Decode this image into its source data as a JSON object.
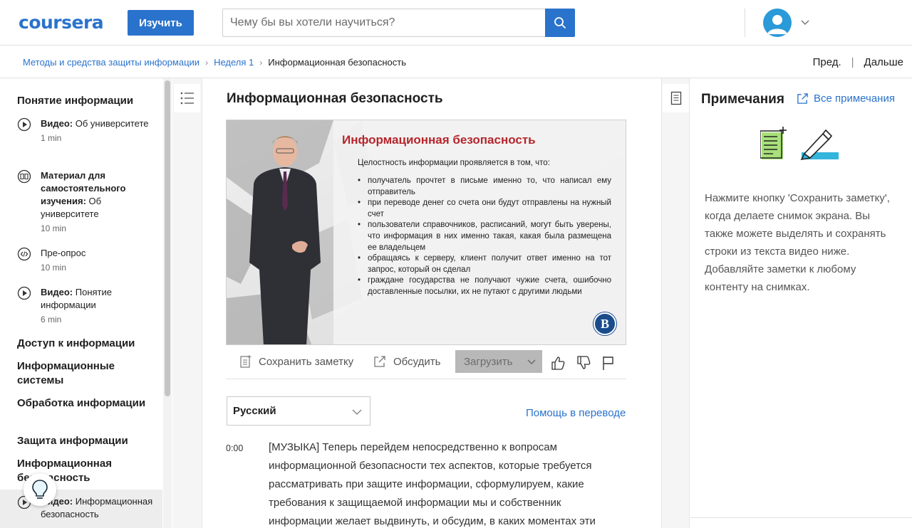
{
  "header": {
    "logo": "coursera",
    "learn_button": "Изучить",
    "search_placeholder": "Чему бы вы хотели научиться?",
    "icons": {
      "search": "search-icon",
      "avatar": "user-avatar-icon",
      "menu": "chevron-down-icon"
    }
  },
  "breadcrumb": {
    "items": [
      "Методы и средства защиты информации",
      "Неделя 1"
    ],
    "current": "Информационная безопасность",
    "prev": "Пред.",
    "separator": "|",
    "next": "Дальше"
  },
  "sidebar": {
    "sections": [
      {
        "title": "Понятие информации"
      },
      {
        "title": "Доступ к информации"
      },
      {
        "title": "Информационные системы"
      },
      {
        "title": "Обработка информации"
      },
      {
        "title": "Защита информации"
      },
      {
        "title": "Информационная безопасность"
      }
    ],
    "items": [
      {
        "type": "Видео:",
        "label": "Об университете",
        "duration": "1 min",
        "icon": "play-icon"
      },
      {
        "type": "Материал для самостоятельного изучения:",
        "label": "Об университете",
        "duration": "10 min",
        "icon": "book-icon"
      },
      {
        "type": "",
        "label": "Пре-опрос",
        "duration": "10 min",
        "icon": "code-icon"
      },
      {
        "type": "Видео:",
        "label": "Понятие информации",
        "duration": "6 min",
        "icon": "play-icon"
      },
      {
        "type": "Видео:",
        "label": "Информационная безопасность",
        "duration": "",
        "icon": "play-icon"
      }
    ]
  },
  "lesson": {
    "title": "Информационная безопасность",
    "slide": {
      "title": "Информационная безопасность",
      "intro": "Целостность информации проявляется в том, что:",
      "bullets": [
        "получатель прочтет в письме именно то, что написал ему отправитель",
        "при переводе денег со счета они будут отправлены на нужный счет",
        "пользователи справочников, расписаний, могут быть уверены, что информация в них именно такая, какая была размещена ее владельцем",
        "обращаясь к серверу, клиент получит ответ именно на тот запрос, который он сделал",
        "граждане государства не получают чужие счета, ошибочно доставленные посылки, их не путают с другими людьми"
      ],
      "logo_text": "В"
    },
    "actions": {
      "save_note": "Сохранить заметку",
      "discuss": "Обсудить",
      "download": "Загрузить"
    },
    "language": "Русский",
    "help_translate": "Помощь в переводе",
    "transcript": {
      "timestamp": "0:00",
      "text": "[МУЗЫКА] Теперь перейдем непосредственно к вопросам информационной безопасности тех аспектов, которые требуется рассматривать при защите информации, сформулируем, какие требования к защищаемой информации мы и собственник информации желает выдвинуть, и обсудим, в каких моментах эти"
    }
  },
  "notes": {
    "title": "Примечания",
    "all_notes": "Все примечания",
    "description": "Нажмите кнопку 'Сохранить заметку', когда делаете снимок экрана. Вы также можете выделять и сохранять строки из текста видео ниже. Добавляйте заметки к любому контенту на снимках."
  },
  "colors": {
    "accent": "#2a73cc",
    "slide_title": "#b5262c",
    "avatar": "#2a9ad8"
  }
}
